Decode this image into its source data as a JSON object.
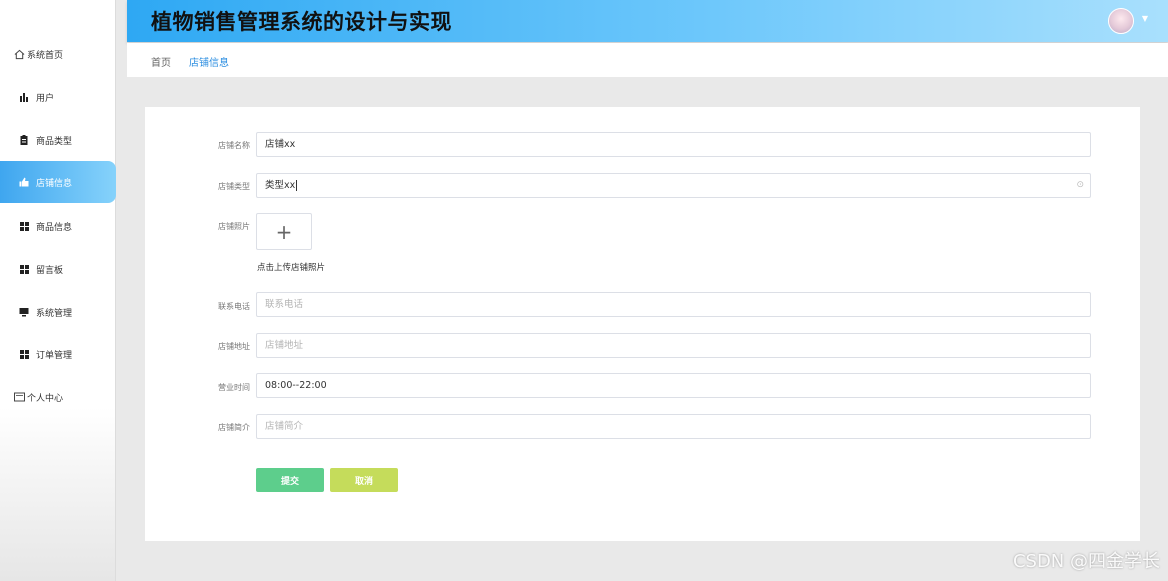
{
  "header": {
    "title": "植物销售管理系统的设计与实现",
    "avatar_caret": "▼"
  },
  "sidebar": {
    "items": [
      {
        "label": "系统首页",
        "icon": "home-icon"
      },
      {
        "label": "用户",
        "icon": "bar-chart-icon"
      },
      {
        "label": "商品类型",
        "icon": "clipboard-icon"
      },
      {
        "label": "店铺信息",
        "icon": "thumbs-up-icon",
        "active": true
      },
      {
        "label": "商品信息",
        "icon": "grid-icon"
      },
      {
        "label": "留言板",
        "icon": "grid-icon"
      },
      {
        "label": "系统管理",
        "icon": "monitor-icon"
      },
      {
        "label": "订单管理",
        "icon": "grid-icon"
      },
      {
        "label": "个人中心",
        "icon": "id-card-icon"
      }
    ]
  },
  "breadcrumb": {
    "home": "首页",
    "current": "店铺信息"
  },
  "form": {
    "shop_name": {
      "label": "店铺名称",
      "value": "店铺xx"
    },
    "shop_type": {
      "label": "店铺类型",
      "value": "类型xx"
    },
    "shop_photo": {
      "label": "店铺照片",
      "upload_icon": "+",
      "hint": "点击上传店铺照片"
    },
    "phone": {
      "label": "联系电话",
      "placeholder": "联系电话"
    },
    "address": {
      "label": "店铺地址",
      "placeholder": "店铺地址"
    },
    "hours": {
      "label": "营业时间",
      "value": "08:00--22:00"
    },
    "intro": {
      "label": "店铺简介",
      "placeholder": "店铺简介"
    }
  },
  "buttons": {
    "submit": "提交",
    "cancel": "取消"
  },
  "watermark": "CSDN @四金学长",
  "colors": {
    "accent": "#2a8de0",
    "submit": "#5dce8c",
    "cancel": "#c5dc5b",
    "sidebar_active": "#3fa6ef"
  }
}
